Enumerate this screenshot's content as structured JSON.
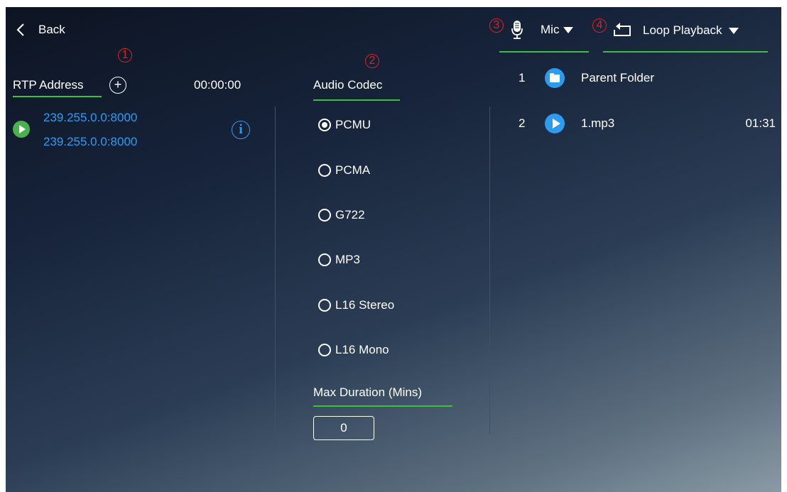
{
  "header": {
    "back_label": "Back",
    "mic_label": "Mic",
    "playback_label": "Loop Playback"
  },
  "callouts": [
    "1",
    "2",
    "3",
    "4"
  ],
  "rtp": {
    "title": "RTP Address",
    "add_symbol": "+",
    "timer": "00:00:00",
    "addresses": [
      "239.255.0.0:8000",
      "239.255.0.0:8000"
    ],
    "info_symbol": "i"
  },
  "codec": {
    "title": "Audio Codec",
    "options": [
      "PCMU",
      "PCMA",
      "G722",
      "MP3",
      "L16 Stereo",
      "L16 Mono"
    ],
    "selected": "PCMU",
    "max_duration_label": "Max Duration (Mins)",
    "max_duration_value": "0"
  },
  "files": [
    {
      "index": "1",
      "name": "Parent Folder",
      "duration": ""
    },
    {
      "index": "2",
      "name": "1.mp3",
      "duration": "01:31"
    }
  ],
  "colors": {
    "accent_green": "#3fbf3f",
    "link_blue": "#2d9cf0",
    "callout_red": "#e02020",
    "play_green": "#4caf50"
  },
  "icons": [
    "chevron-left-icon",
    "plus-circle-icon",
    "play-icon",
    "info-icon",
    "mic-icon",
    "caret-down-icon",
    "loop-icon",
    "folder-icon"
  ]
}
